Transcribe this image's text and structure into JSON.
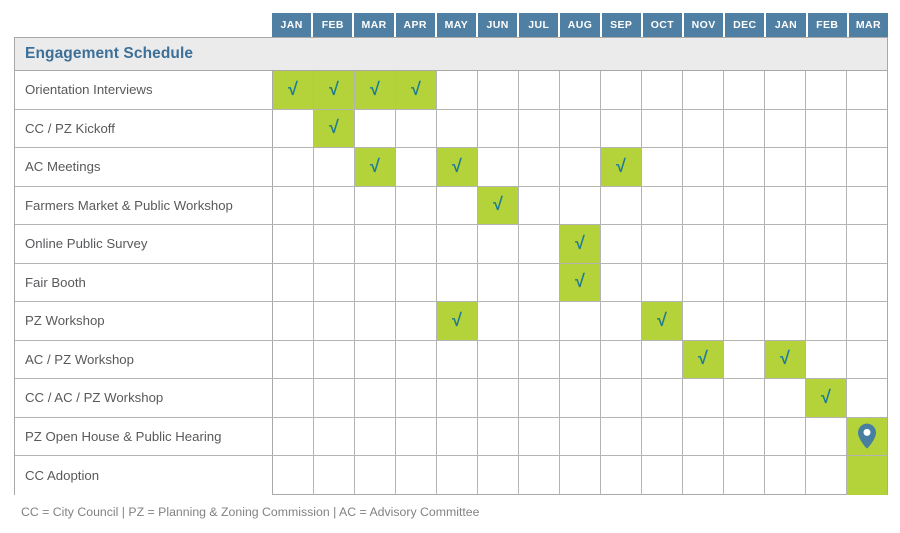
{
  "title": "Engagement Schedule",
  "footnote": "CC = City Council  |  PZ = Planning & Zoning Commission  |  AC = Advisory Committee",
  "colors": {
    "header_blue": "#4f7fa2",
    "title_blue": "#3d7098",
    "title_bg": "#ebebeb",
    "cell_green": "#b4d239",
    "check_teal": "#1b7c94",
    "pin_blue": "#477fa0",
    "grid_line": "#b4b4b4",
    "border": "#a9a9a9",
    "label_text": "#58595b",
    "footnote_text": "#808285"
  },
  "icons": {
    "check": "check-icon",
    "marker": "map-pin-icon"
  },
  "chart_data": {
    "type": "table",
    "title": "Engagement Schedule",
    "xlabel": "",
    "ylabel": "",
    "grid": true,
    "legend_position": "bottom",
    "annotations": [
      "CC = City Council",
      "PZ = Planning & Zoning Commission",
      "AC = Advisory Committee"
    ],
    "categories": [
      "JAN",
      "FEB",
      "MAR",
      "APR",
      "MAY",
      "JUN",
      "JUL",
      "AUG",
      "SEP",
      "OCT",
      "NOV",
      "DEC",
      "JAN",
      "FEB",
      "MAR"
    ],
    "rows": [
      {
        "label": "Orientation Interviews",
        "marks": [
          {
            "col": 0,
            "month": "JAN",
            "marker": "check"
          },
          {
            "col": 1,
            "month": "FEB",
            "marker": "check"
          },
          {
            "col": 2,
            "month": "MAR",
            "marker": "check"
          },
          {
            "col": 3,
            "month": "APR",
            "marker": "check"
          }
        ]
      },
      {
        "label": "CC / PZ Kickoff",
        "marks": [
          {
            "col": 1,
            "month": "FEB",
            "marker": "check"
          }
        ]
      },
      {
        "label": "AC Meetings",
        "marks": [
          {
            "col": 2,
            "month": "MAR",
            "marker": "check"
          },
          {
            "col": 4,
            "month": "MAY",
            "marker": "check"
          },
          {
            "col": 8,
            "month": "SEP",
            "marker": "check"
          }
        ]
      },
      {
        "label": "Farmers Market & Public Workshop",
        "marks": [
          {
            "col": 5,
            "month": "JUN",
            "marker": "check"
          }
        ]
      },
      {
        "label": "Online Public Survey",
        "marks": [
          {
            "col": 7,
            "month": "AUG",
            "marker": "check"
          }
        ]
      },
      {
        "label": "Fair Booth",
        "marks": [
          {
            "col": 7,
            "month": "AUG",
            "marker": "check"
          }
        ]
      },
      {
        "label": "PZ Workshop",
        "marks": [
          {
            "col": 4,
            "month": "MAY",
            "marker": "check"
          },
          {
            "col": 9,
            "month": "OCT",
            "marker": "check"
          }
        ]
      },
      {
        "label": "AC / PZ Workshop",
        "marks": [
          {
            "col": 10,
            "month": "NOV",
            "marker": "check"
          },
          {
            "col": 12,
            "month": "JAN",
            "marker": "check"
          }
        ]
      },
      {
        "label": "CC / AC / PZ Workshop",
        "marks": [
          {
            "col": 13,
            "month": "FEB",
            "marker": "check"
          }
        ]
      },
      {
        "label": "PZ Open House & Public Hearing",
        "marks": [
          {
            "col": 14,
            "month": "MAR",
            "marker": "marker"
          }
        ]
      },
      {
        "label": "CC Adoption",
        "marks": [
          {
            "col": 14,
            "month": "MAR",
            "marker": "none"
          }
        ]
      }
    ]
  }
}
